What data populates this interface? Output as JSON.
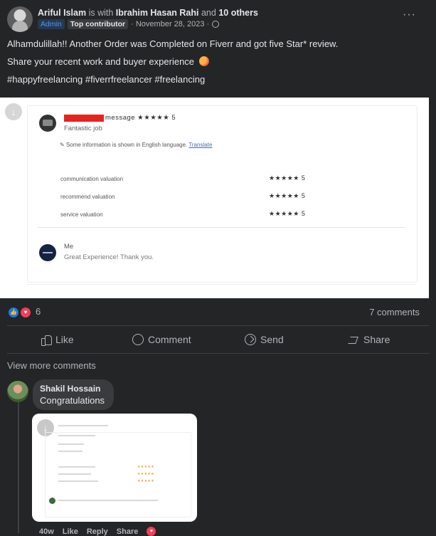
{
  "post": {
    "author": "Ariful Islam",
    "with_text": "is with",
    "tagged": "Ibrahim Hasan Rahi",
    "and_text": "and",
    "others": "10 others",
    "badge_admin": "Admin",
    "badge_top": "Top contributor",
    "date": "· November 28, 2023 ·",
    "more": "···",
    "lines": [
      "Alhamdulillah!! Another Order was Completed on Fiverr and got five Star* review.",
      "Share your recent work and buyer experience",
      "#happyfreelancing #fiverrfreelancer #freelancing"
    ]
  },
  "review_image": {
    "header_suffix": "message ★★★★★ 5",
    "comment": "Fantastic job",
    "info_text": "Some information is shown in English language.",
    "translate": "Translate",
    "valuations": [
      {
        "label": "communication valuation",
        "stars": "★★★★★ 5"
      },
      {
        "label": "recommend valuation",
        "stars": "★★★★★ 5"
      },
      {
        "label": "service valuation",
        "stars": "★★★★★ 5"
      }
    ],
    "reply_name": "Me",
    "reply_text": "Great Experience! Thank you."
  },
  "stats": {
    "reaction_count": "6",
    "comments": "7 comments"
  },
  "actions": {
    "like": "Like",
    "comment": "Comment",
    "send": "Send",
    "share": "Share"
  },
  "view_more": "View more comments",
  "comment": {
    "author": "Shakil Hossain",
    "text": "Congratulations",
    "actions": [
      "40w",
      "Like",
      "Reply",
      "Share"
    ]
  },
  "colors": {
    "background": "#242526",
    "accent": "#1877f2",
    "love": "#f33e58"
  }
}
